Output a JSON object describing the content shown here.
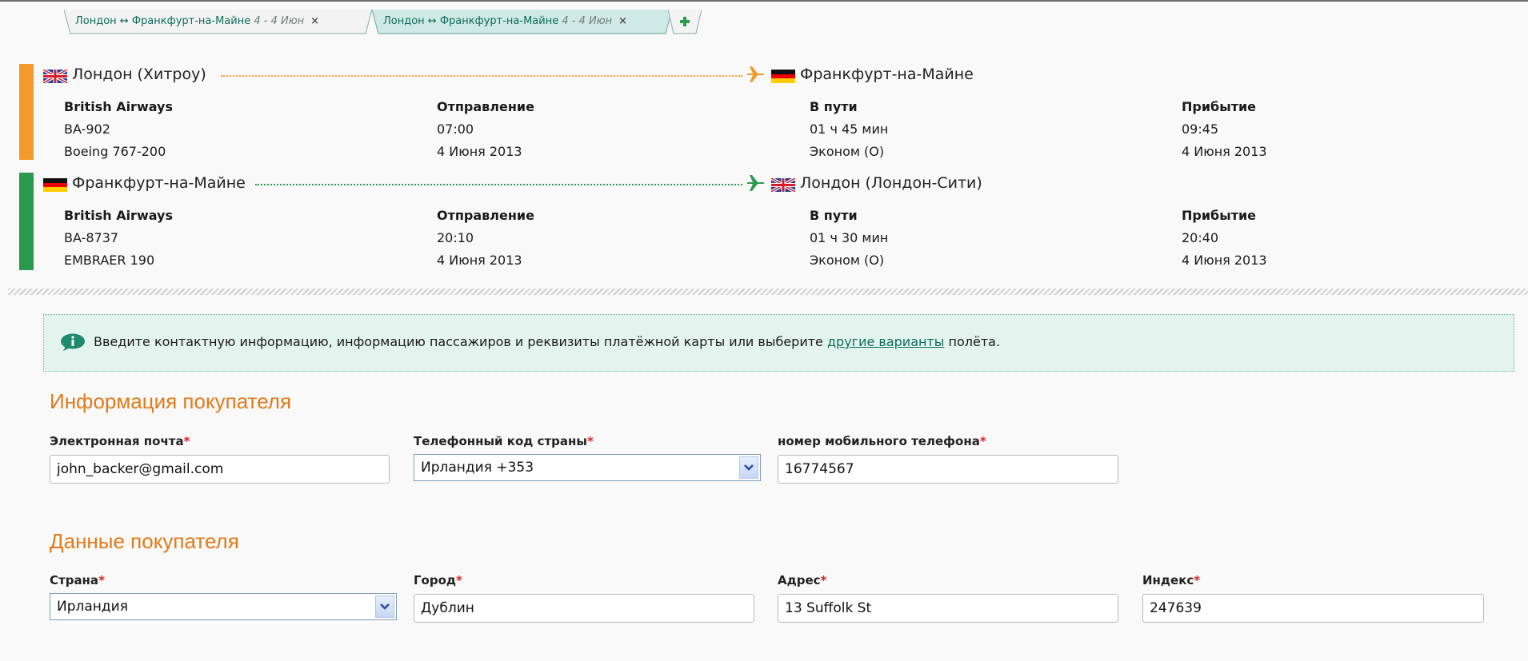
{
  "tabs": [
    {
      "route": "Лондон ↔ Франкфурт-на-Майне",
      "dates": "4 - 4 Июн",
      "close": "×"
    },
    {
      "route": "Лондон ↔ Франкфурт-на-Майне",
      "dates": "4 - 4 Июн",
      "close": "×"
    }
  ],
  "add_tab_icon": "plus-icon",
  "flights": [
    {
      "color": "#f39a2c",
      "from": "Лондон (Хитроу)",
      "from_flag": "uk-flag-icon",
      "to": "Франкфурт-на-Майне",
      "to_flag": "germany-flag-icon",
      "airline": "British Airways",
      "flight_no": "BA-902",
      "aircraft": "Boeing 767-200",
      "departure_label": "Отправление",
      "departure_time": "07:00",
      "departure_date": "4 Июня 2013",
      "duration_label": "В пути",
      "duration": "01 ч 45 мин",
      "cabin": "Эконом (O)",
      "arrival_label": "Прибытие",
      "arrival_time": "09:45",
      "arrival_date": "4 Июня 2013"
    },
    {
      "color": "#2b9a4c",
      "from": "Франкфурт-на-Майне",
      "from_flag": "germany-flag-icon",
      "to": "Лондон (Лондон-Сити)",
      "to_flag": "uk-flag-icon",
      "airline": "British Airways",
      "flight_no": "BA-8737",
      "aircraft": "EMBRAER 190",
      "departure_label": "Отправление",
      "departure_time": "20:10",
      "departure_date": "4 Июня 2013",
      "duration_label": "В пути",
      "duration": "01 ч 30 мин",
      "cabin": "Эконом (O)",
      "arrival_label": "Прибытие",
      "arrival_time": "20:40",
      "arrival_date": "4 Июня 2013"
    }
  ],
  "info": {
    "text_before": "Введите контактную информацию, информацию пассажиров и реквизиты платёжной карты или выберите",
    "link": "другие варианты",
    "text_after": "полёта."
  },
  "buyer_info": {
    "heading": "Информация покупателя",
    "email_label": "Электронная почта",
    "email_value": "john_backer@gmail.com",
    "phone_code_label": "Телефонный код страны",
    "phone_code_value": "Ирландия +353",
    "mobile_label": "номер мобильного телефона",
    "mobile_value": "16774567"
  },
  "buyer_data": {
    "heading": "Данные покупателя",
    "country_label": "Страна",
    "country_value": "Ирландия",
    "city_label": "Город",
    "city_value": "Дублин",
    "address_label": "Адрес",
    "address_value": "13 Suffolk St",
    "zip_label": "Индекс",
    "zip_value": "247639"
  },
  "required_mark": "*",
  "colors": {
    "accent_orange": "#e27a1a",
    "teal": "#0e6b5a",
    "required": "#e02020"
  }
}
